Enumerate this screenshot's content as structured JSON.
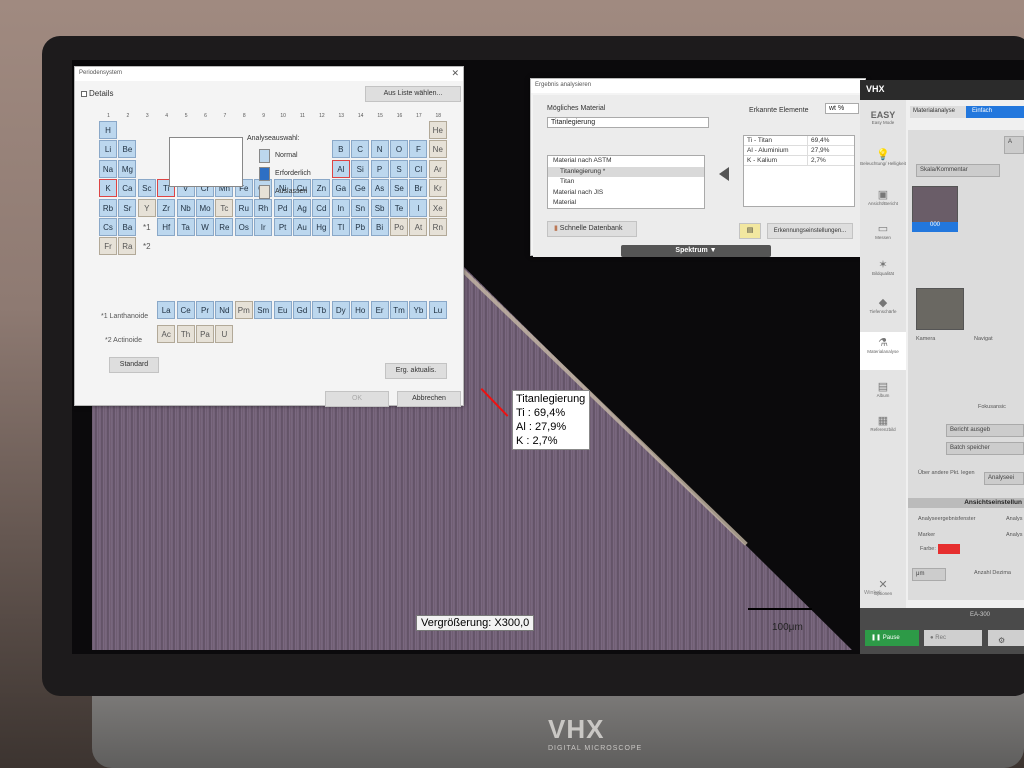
{
  "brand": {
    "logo": "VHX",
    "sub": "DIGITAL MICROSCOPE"
  },
  "image": {
    "magnification": "Vergrößerung: X300,0",
    "scale_label": "100μm",
    "annotation": {
      "title": "Titanlegierung",
      "lines": [
        "Ti : 69,4%",
        "Al : 27,9%",
        "K : 2,7%"
      ]
    }
  },
  "periodic_dialog": {
    "title": "Periodensystem",
    "details_label": "Details",
    "from_list_button": "Aus Liste wählen...",
    "groups": [
      "1",
      "2",
      "3",
      "4",
      "5",
      "6",
      "7",
      "8",
      "9",
      "10",
      "11",
      "12",
      "13",
      "14",
      "15",
      "16",
      "17",
      "18"
    ],
    "analysis_label": "Analyseauswahl:",
    "legend": [
      "Normal",
      "Erforderlich",
      "Auslassen"
    ],
    "lanthanoid_label": "*1 Lanthanoide",
    "actinoid_label": "*2 Actinoide",
    "star1": "*1",
    "star2": "*2",
    "standard_button": "Standard",
    "update_button": "Erg. aktualis.",
    "ok_button": "OK",
    "cancel_button": "Abbrechen",
    "elements": [
      [
        "H",
        "",
        "",
        "",
        "",
        "",
        "",
        "",
        "",
        "",
        "",
        "",
        "",
        "",
        "",
        "",
        "",
        "He"
      ],
      [
        "Li",
        "Be",
        "",
        "",
        "",
        "",
        "",
        "",
        "",
        "",
        "",
        "",
        "B",
        "C",
        "N",
        "O",
        "F",
        "Ne"
      ],
      [
        "Na",
        "Mg",
        "",
        "",
        "",
        "",
        "",
        "",
        "",
        "",
        "",
        "",
        "Al",
        "Si",
        "P",
        "S",
        "Cl",
        "Ar"
      ],
      [
        "K",
        "Ca",
        "Sc",
        "Ti",
        "V",
        "Cr",
        "Mn",
        "Fe",
        "Co",
        "Ni",
        "Cu",
        "Zn",
        "Ga",
        "Ge",
        "As",
        "Se",
        "Br",
        "Kr"
      ],
      [
        "Rb",
        "Sr",
        "Y",
        "Zr",
        "Nb",
        "Mo",
        "Tc",
        "Ru",
        "Rh",
        "Pd",
        "Ag",
        "Cd",
        "In",
        "Sn",
        "Sb",
        "Te",
        "I",
        "Xe"
      ],
      [
        "Cs",
        "Ba",
        "*1",
        "Hf",
        "Ta",
        "W",
        "Re",
        "Os",
        "Ir",
        "Pt",
        "Au",
        "Hg",
        "Tl",
        "Pb",
        "Bi",
        "Po",
        "At",
        "Rn"
      ],
      [
        "Fr",
        "Ra",
        "*2",
        "",
        "",
        "",
        "",
        "",
        "",
        "",
        "",
        "",
        "",
        "",
        "",
        "",
        "",
        ""
      ]
    ],
    "lanthanoids": [
      "La",
      "Ce",
      "Pr",
      "Nd",
      "Pm",
      "Sm",
      "Eu",
      "Gd",
      "Tb",
      "Dy",
      "Ho",
      "Er",
      "Tm",
      "Yb",
      "Lu"
    ],
    "actinoids": [
      "Ac",
      "Th",
      "Pa",
      "U"
    ]
  },
  "result_dialog": {
    "title": "Ergebnis analysieren",
    "possible_material_label": "Mögliches Material",
    "material_value": "Titanlegierung",
    "tree": [
      "Material nach ASTM",
      "Titanlegierung *",
      "Titan",
      "Material nach JIS",
      "Material"
    ],
    "detected_label": "Erkannte Elemente",
    "unit": "wt %",
    "elements": [
      {
        "name": "Ti - Titan",
        "value": "69,4%"
      },
      {
        "name": "Al - Aluminium",
        "value": "27,9%"
      },
      {
        "name": "K - Kalium",
        "value": "2,7%"
      }
    ],
    "quick_db_button": "Schnelle Datenbank",
    "settings_button": "Erkennungseinstellungen...",
    "spectrum_button": "Spektrum"
  },
  "vhx_panel": {
    "title": "VHX",
    "easy": "EASY",
    "easy_mode": "Easy Mode",
    "side": [
      "Beleuchtung/ Helligkeit",
      "Ansicht/Bericht",
      "Messen",
      "Bildqualität",
      "Tiefenschärfe",
      "Materialanalyse",
      "Album",
      "Referenzbild",
      "Optionen"
    ],
    "tab_active": "Materialanalyse",
    "tab_mode": "Einfach",
    "scale_comment_button": "Skala/Kommentar",
    "thumb_label": "000",
    "camera_label": "Kamera",
    "navigation_label": "Navigat",
    "focus_label": "Fokusansic",
    "report_button": "Bericht ausgeb",
    "batch_button": "Batch speicher",
    "other_points_label": "Über andere Pkt. legen",
    "analysis_button": "Analyseei",
    "view_settings_label": "Ansichtseinstellun",
    "result_window_label": "Analyseergebnisfenster",
    "result_window_value": "Analys",
    "marker_label": "Marker",
    "analysis_label": "Analys",
    "color_label": "Farbe:",
    "marker_color": "#e62e2e",
    "unit_value": "μm",
    "count_label": "Anzahl Dezima",
    "lens_label": "Winkel",
    "lens_value": "EA-300",
    "pause_button": "Pause",
    "rec_button": "Rec"
  }
}
